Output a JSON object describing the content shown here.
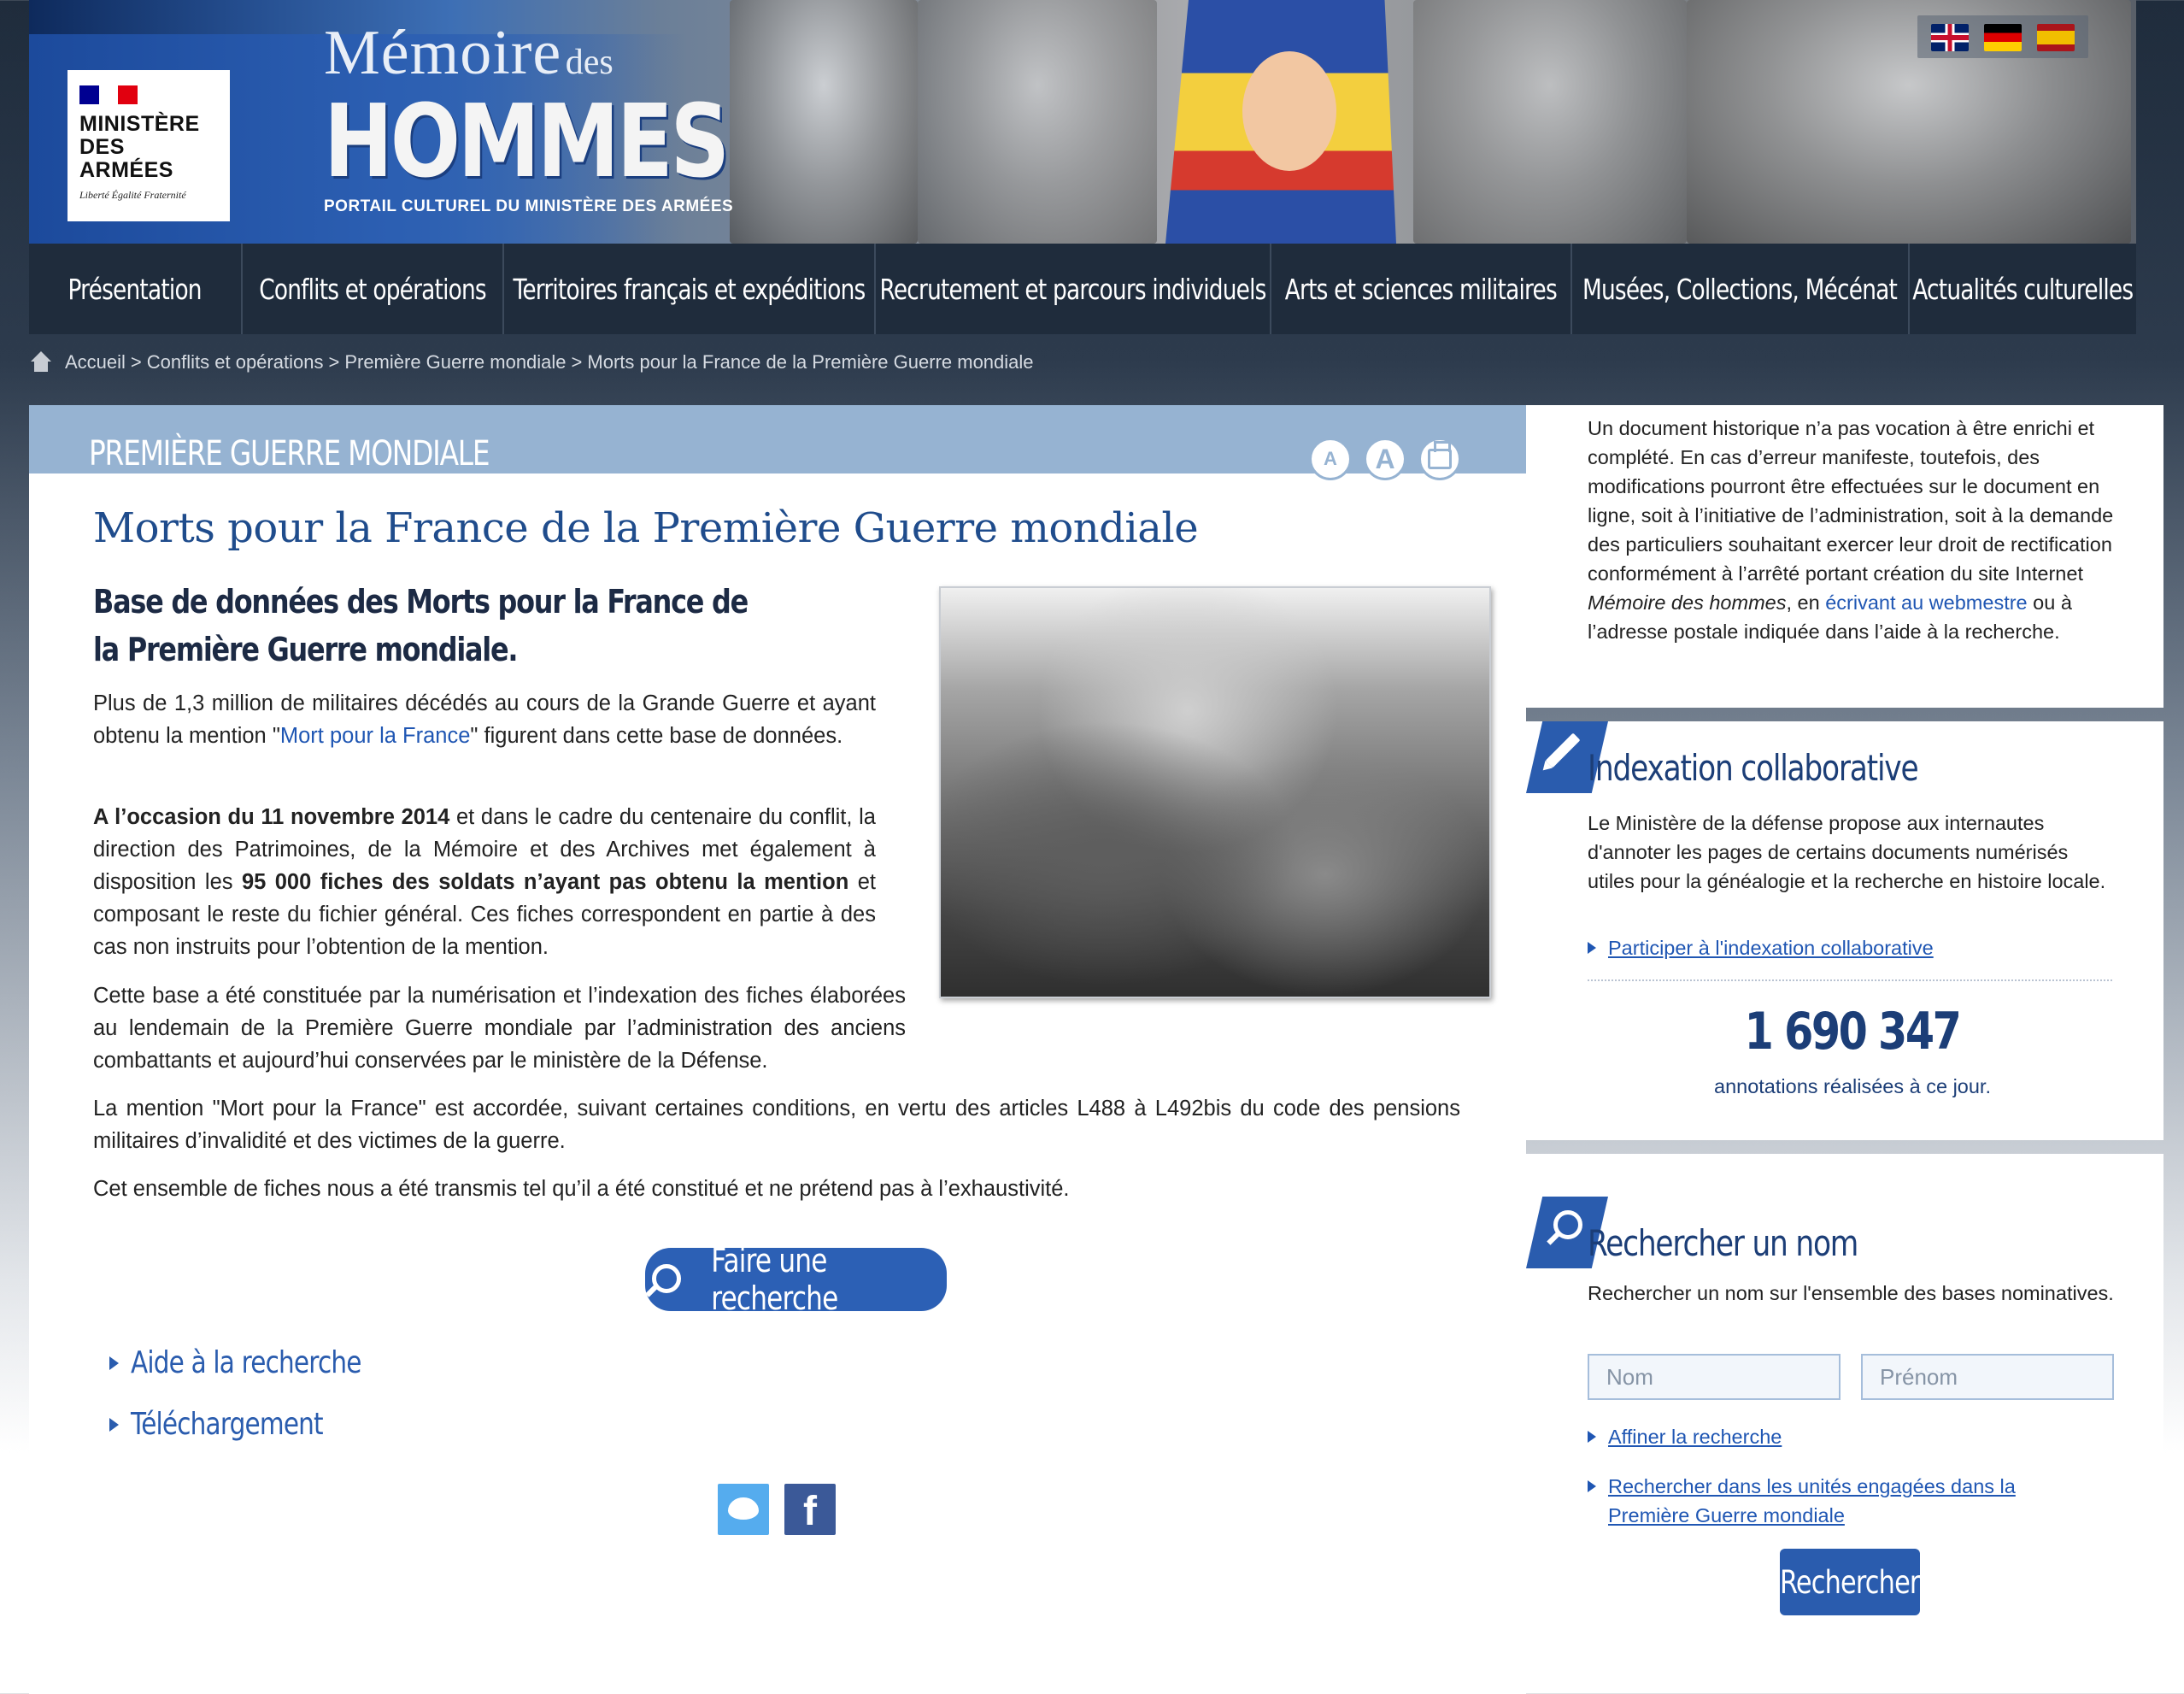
{
  "header": {
    "ministry_logo_text": "MINISTÈRE DES ARMÉES",
    "ministry_motto": "Liberté Égalité Fraternité",
    "site_title_line1": "Mémoire",
    "site_title_line1_small": "des",
    "site_title_line2": "HOMMES",
    "site_subtitle": "PORTAIL CULTUREL DU MINISTÈRE DES ARMÉES",
    "languages": [
      "English",
      "Deutsch",
      "Español"
    ]
  },
  "nav": {
    "items": [
      "Présentation",
      "Conflits et opérations",
      "Territoires français et expéditions",
      "Recrutement et parcours individuels",
      "Arts et sciences militaires",
      "Musées, Collections, Mécénat",
      "Actualités culturelles"
    ]
  },
  "breadcrumb": [
    "Accueil",
    "Conflits et opérations",
    "Première Guerre mondiale",
    "Morts pour la France de la Première Guerre mondiale"
  ],
  "breadcrumb_separator": ">",
  "section": {
    "title": "PREMIÈRE GUERRE MONDIALE",
    "tool_small_a": "A",
    "tool_big_a": "A"
  },
  "article": {
    "title": "Morts pour la France de la Première Guerre mondiale",
    "subtitle": "Base de données des Morts pour la France de la Première Guerre mondiale.",
    "p1_before": "Plus de 1,3 million de militaires décédés au cours de la Grande Guerre et ayant obtenu la mention \"",
    "p1_link": "Mort pour la France",
    "p1_after": "\" figurent dans cette base de données.",
    "p2_bold1": "A l’occasion du 11 novembre 2014",
    "p2_mid": " et dans le cadre du centenaire du conflit, la direction des Patrimoines, de la Mémoire et des Archives met également à disposition les ",
    "p2_bold2": "95 000 fiches des soldats n’ayant pas obtenu la mention",
    "p2_end": " et composant le reste du fichier général. Ces fiches correspondent en partie à des cas non instruits pour l’obtention de la mention.",
    "p3": "Cette base a été constituée par la numérisation et l’indexation des fiches élaborées au lendemain de la Première Guerre mondiale par l’administration des anciens combattants et aujourd’hui conservées par le ministère de la Défense.",
    "p4": "La mention \"Mort pour la France\" est accordée, suivant certaines conditions, en vertu des articles L488 à L492bis du code des pensions militaires d’invalidité et des victimes de la guerre.",
    "p5": "Cet ensemble de fiches nous a été transmis tel qu’il a été constitué et ne prétend pas à l’exhaustivité.",
    "search_button": "Faire une recherche",
    "link_help": "Aide à la recherche",
    "link_download": "Téléchargement",
    "social_facebook": "f"
  },
  "sidebar": {
    "intro_before": "Un document historique n’a pas vocation à être enrichi et complété. En cas d’erreur manifeste, toutefois, des modifications pourront être effectuées sur le document en ligne, soit à l’initiative de l’administration, soit à la demande des particuliers souhaitant exercer leur droit de rectification conformément à l’arrêté portant création du site Internet ",
    "intro_italic": "Mémoire des hommes",
    "intro_mid": ", en ",
    "intro_link": "écrivant au webmestre",
    "intro_after": " ou à l’adresse postale indiquée dans l’aide à la recherche.",
    "indexation_title": "Indexation collaborative",
    "indexation_text": "Le Ministère de la défense propose aux internautes d'annoter les pages de certains documents numérisés utiles pour la généalogie et la recherche en histoire locale.",
    "indexation_link": "Participer à l'indexation collaborative",
    "annotation_count": "1 690 347",
    "annotation_label": "annotations réalisées à ce jour.",
    "search_title": "Rechercher un nom",
    "search_text": "Rechercher un nom sur l'ensemble des bases nominatives.",
    "nom_placeholder": "Nom",
    "prenom_placeholder": "Prénom",
    "refine_link": "Affiner la recherche",
    "units_link": "Rechercher dans les unités engagées dans la Première Guerre mondiale",
    "search_button": "Rechercher"
  },
  "colors": {
    "nav_bg": "#1f2c3c",
    "accent_blue": "#2a5cae",
    "title_blue": "#1f4c8c",
    "section_header_bg": "#96b3d2"
  }
}
